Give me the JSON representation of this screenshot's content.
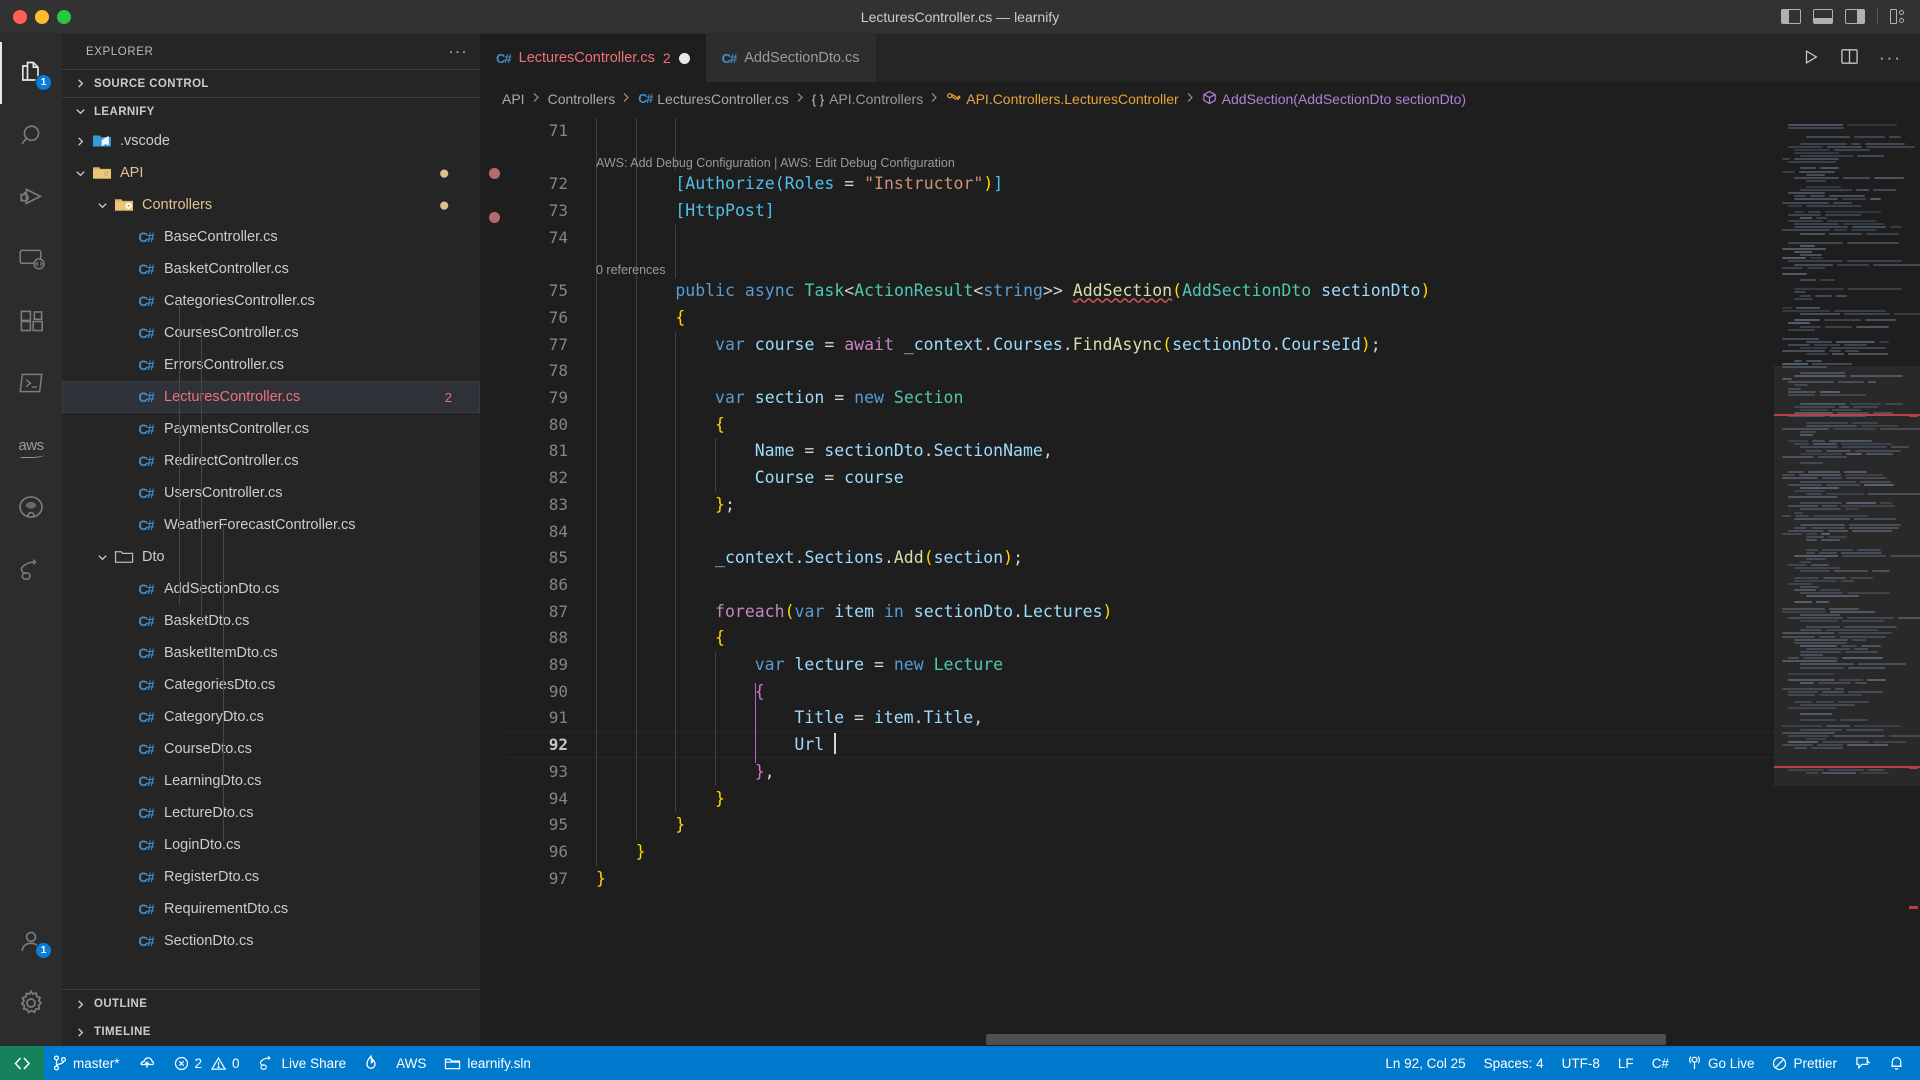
{
  "window": {
    "title": "LecturesController.cs — learnify",
    "layout_icons": [
      "panel-left-icon",
      "panel-bottom-icon",
      "panel-right-icon",
      "customize-layout-icon"
    ]
  },
  "activitybar": {
    "items": [
      {
        "name": "explorer-icon",
        "badge": "1",
        "active": true
      },
      {
        "name": "search-icon",
        "badge": "",
        "active": false
      },
      {
        "name": "run-and-debug-icon",
        "badge": "",
        "active": false
      },
      {
        "name": "remote-explorer-icon",
        "badge": "",
        "active": false
      },
      {
        "name": "extensions-icon",
        "badge": "",
        "active": false
      },
      {
        "name": "terminal-icon",
        "badge": "",
        "active": false
      },
      {
        "name": "aws-icon",
        "badge": "",
        "active": false,
        "text": "aws"
      },
      {
        "name": "github-icon",
        "badge": "",
        "active": false
      },
      {
        "name": "live-share-icon",
        "badge": "",
        "active": false
      }
    ],
    "bottom_items": [
      {
        "name": "accounts-icon",
        "badge": "1"
      },
      {
        "name": "settings-gear-icon",
        "badge": ""
      }
    ]
  },
  "sidebar": {
    "header_title": "EXPLORER",
    "more_actions": "···",
    "source_control_label": "SOURCE CONTROL",
    "project_label": "LEARNIFY",
    "outline_label": "OUTLINE",
    "timeline_label": "TIMELINE",
    "tree": [
      {
        "label": ".vscode",
        "depth": 1,
        "kind": "folder-vscode",
        "state": "collapsed"
      },
      {
        "label": "API",
        "depth": 1,
        "kind": "folder-api",
        "state": "expanded",
        "color": "modified",
        "dot": true
      },
      {
        "label": "Controllers",
        "depth": 2,
        "kind": "folder-ctrl",
        "state": "expanded",
        "color": "modified",
        "dot": true
      },
      {
        "label": "BaseController.cs",
        "depth": 3,
        "kind": "cs"
      },
      {
        "label": "BasketController.cs",
        "depth": 3,
        "kind": "cs"
      },
      {
        "label": "CategoriesController.cs",
        "depth": 3,
        "kind": "cs"
      },
      {
        "label": "CoursesController.cs",
        "depth": 3,
        "kind": "cs"
      },
      {
        "label": "ErrorsController.cs",
        "depth": 3,
        "kind": "cs"
      },
      {
        "label": "LecturesController.cs",
        "depth": 3,
        "kind": "cs",
        "selected": true,
        "color": "error",
        "error_count": "2"
      },
      {
        "label": "PaymentsController.cs",
        "depth": 3,
        "kind": "cs"
      },
      {
        "label": "RedirectController.cs",
        "depth": 3,
        "kind": "cs"
      },
      {
        "label": "UsersController.cs",
        "depth": 3,
        "kind": "cs"
      },
      {
        "label": "WeatherForecastController.cs",
        "depth": 3,
        "kind": "cs"
      },
      {
        "label": "Dto",
        "depth": 2,
        "kind": "folder-plain",
        "state": "expanded"
      },
      {
        "label": "AddSectionDto.cs",
        "depth": 3,
        "kind": "cs"
      },
      {
        "label": "BasketDto.cs",
        "depth": 3,
        "kind": "cs"
      },
      {
        "label": "BasketItemDto.cs",
        "depth": 3,
        "kind": "cs"
      },
      {
        "label": "CategoriesDto.cs",
        "depth": 3,
        "kind": "cs"
      },
      {
        "label": "CategoryDto.cs",
        "depth": 3,
        "kind": "cs"
      },
      {
        "label": "CourseDto.cs",
        "depth": 3,
        "kind": "cs"
      },
      {
        "label": "LearningDto.cs",
        "depth": 3,
        "kind": "cs"
      },
      {
        "label": "LectureDto.cs",
        "depth": 3,
        "kind": "cs"
      },
      {
        "label": "LoginDto.cs",
        "depth": 3,
        "kind": "cs"
      },
      {
        "label": "RegisterDto.cs",
        "depth": 3,
        "kind": "cs"
      },
      {
        "label": "RequirementDto.cs",
        "depth": 3,
        "kind": "cs"
      },
      {
        "label": "SectionDto.cs",
        "depth": 3,
        "kind": "cs"
      }
    ]
  },
  "tabs": [
    {
      "label": "LecturesController.cs",
      "icon": "csharp-icon",
      "error_count": "2",
      "dirty": true,
      "active": true
    },
    {
      "label": "AddSectionDto.cs",
      "icon": "csharp-icon",
      "error_count": "",
      "dirty": false,
      "active": false
    }
  ],
  "editor_actions": [
    "run-icon",
    "split-editor-icon",
    "more-actions-icon"
  ],
  "breadcrumb": [
    {
      "text": "API",
      "kind": "plain"
    },
    {
      "text": "Controllers",
      "kind": "plain"
    },
    {
      "text": "LecturesController.cs",
      "kind": "file"
    },
    {
      "text": "API.Controllers",
      "kind": "namespace"
    },
    {
      "text": "API.Controllers.LecturesController",
      "kind": "class"
    },
    {
      "text": "AddSection(AddSectionDto sectionDto)",
      "kind": "method"
    }
  ],
  "code": {
    "first_line": 71,
    "codelens_72": "AWS: Add Debug Configuration | AWS: Edit Debug Configuration",
    "codelens_75": "0 references",
    "lines": [
      {
        "n": 71,
        "text": ""
      },
      {
        "n": 72,
        "text": "[Authorize(Roles = \"Instructor\")]"
      },
      {
        "n": 73,
        "text": "[HttpPost]"
      },
      {
        "n": 74,
        "text": ""
      },
      {
        "n": 75,
        "text": "public async Task<ActionResult<string>> AddSection(AddSectionDto sectionDto)"
      },
      {
        "n": 76,
        "text": "{"
      },
      {
        "n": 77,
        "text": "var course = await _context.Courses.FindAsync(sectionDto.CourseId);"
      },
      {
        "n": 78,
        "text": ""
      },
      {
        "n": 79,
        "text": "var section = new Section"
      },
      {
        "n": 80,
        "text": "{"
      },
      {
        "n": 81,
        "text": "Name = sectionDto.SectionName,"
      },
      {
        "n": 82,
        "text": "Course = course"
      },
      {
        "n": 83,
        "text": "};"
      },
      {
        "n": 84,
        "text": ""
      },
      {
        "n": 85,
        "text": "_context.Sections.Add(section);"
      },
      {
        "n": 86,
        "text": ""
      },
      {
        "n": 87,
        "text": "foreach(var item in sectionDto.Lectures)"
      },
      {
        "n": 88,
        "text": "{"
      },
      {
        "n": 89,
        "text": "var lecture = new Lecture"
      },
      {
        "n": 90,
        "text": "{"
      },
      {
        "n": 91,
        "text": "Title = item.Title,"
      },
      {
        "n": 92,
        "text": "Url "
      },
      {
        "n": 93,
        "text": "},"
      },
      {
        "n": 94,
        "text": "}"
      },
      {
        "n": 95,
        "text": "}"
      },
      {
        "n": 96,
        "text": "}"
      },
      {
        "n": 97,
        "text": "}"
      }
    ]
  },
  "statusbar": {
    "remote_label": "remote-window-icon",
    "branch": "master*",
    "sync_label": "sync-changes-icon",
    "errors": "2",
    "warnings": "0",
    "live_share": "Live Share",
    "flame": "flame-icon",
    "aws": "AWS",
    "solution": "learnify.sln",
    "position": "Ln 92, Col 25",
    "spaces": "Spaces: 4",
    "encoding": "UTF-8",
    "eol": "LF",
    "language": "C#",
    "go_live": "Go Live",
    "prettier": "Prettier",
    "feedback": "feedback-icon",
    "bell": "notifications-bell-icon"
  }
}
